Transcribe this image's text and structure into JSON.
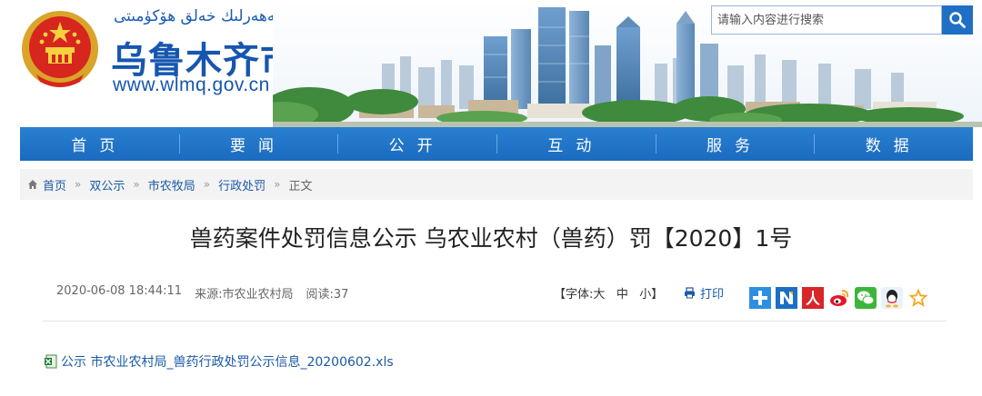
{
  "header": {
    "uyghur_title": "ئۈرۈمچى شەھەرلىك خەلق ھۆكۈمىتى",
    "site_title": "乌鲁木齐市人民政府",
    "site_url": "www.wlmq.gov.cn"
  },
  "search": {
    "placeholder": "请输入内容进行搜索",
    "icon": "search-icon"
  },
  "nav": {
    "items": [
      "首页",
      "要闻",
      "公开",
      "互动",
      "服务",
      "数据"
    ]
  },
  "breadcrumb": {
    "home": "首页",
    "items": [
      "双公示",
      "市农牧局",
      "行政处罚"
    ],
    "current": "正文",
    "separator": "»"
  },
  "article": {
    "title": "兽药案件处罚信息公示 乌农业农村（兽药）罚【2020】1号",
    "date": "2020-06-08 18:44:11",
    "source": "来源:市农业农村局",
    "reads": "阅读:37",
    "font_size": {
      "prefix": "【字体:",
      "large": "大",
      "medium": "中",
      "small": "小",
      "suffix": "】"
    },
    "print_label": "打印",
    "share_icons": [
      "share-plus-icon",
      "share-n-icon",
      "share-people-icon",
      "share-weibo-icon",
      "share-wechat-icon",
      "share-qq-icon",
      "share-favorite-icon"
    ],
    "attachment": "公示 市农业农村局_兽药行政处罚公示信息_20200602.xls"
  },
  "colors": {
    "brand_blue": "#1656b0",
    "nav_blue": "#1f72c6",
    "link_blue": "#1a5aa6"
  }
}
